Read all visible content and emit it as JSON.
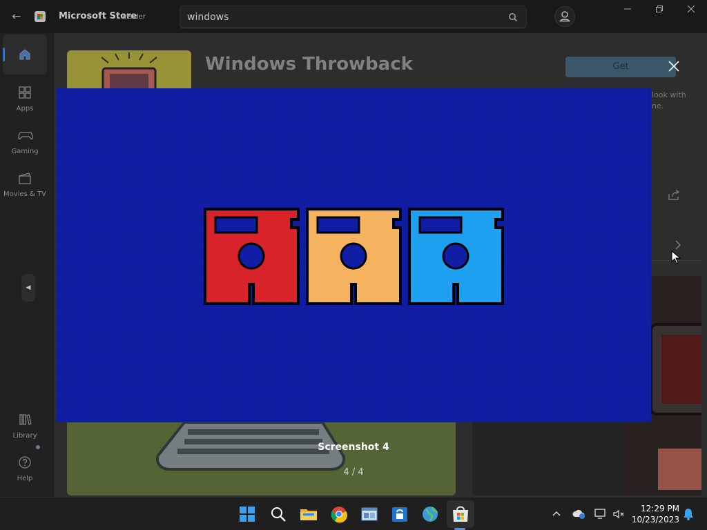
{
  "titlebar": {
    "app_name": "Microsoft Store",
    "badge": "Insider",
    "search_value": "windows",
    "controls": [
      "minimize-icon",
      "maximize-icon",
      "close-icon"
    ]
  },
  "sidebar": {
    "items": [
      {
        "label": "",
        "icon": "home-icon",
        "active": true
      },
      {
        "label": "Apps",
        "icon": "apps-icon"
      },
      {
        "label": "Gaming",
        "icon": "gamepad-icon"
      },
      {
        "label": "Movies & TV",
        "icon": "clapperboard-icon"
      },
      {
        "label": "Library",
        "icon": "library-icon"
      },
      {
        "label": "Help",
        "icon": "help-icon"
      }
    ]
  },
  "product": {
    "title": "Windows Throwback",
    "get_label": "Get",
    "description_fragment": "look with\nne."
  },
  "viewer": {
    "caption": "Screenshot 4",
    "counter": "4 / 4"
  },
  "taskbar": {
    "apps": [
      "windows-start-icon",
      "search-icon",
      "file-explorer-icon",
      "chrome-icon",
      "window-app-icon",
      "store-bag-icon",
      "globe-app-icon",
      "microsoft-store-icon"
    ],
    "time": "12:29 PM",
    "date": "10/23/2023"
  },
  "colors": {
    "accent": "#4f8ee6",
    "viewer_background": "#0f1ea5",
    "disk_red": "#d8232a",
    "disk_orange": "#f5b25f",
    "disk_blue": "#1da0ef"
  }
}
